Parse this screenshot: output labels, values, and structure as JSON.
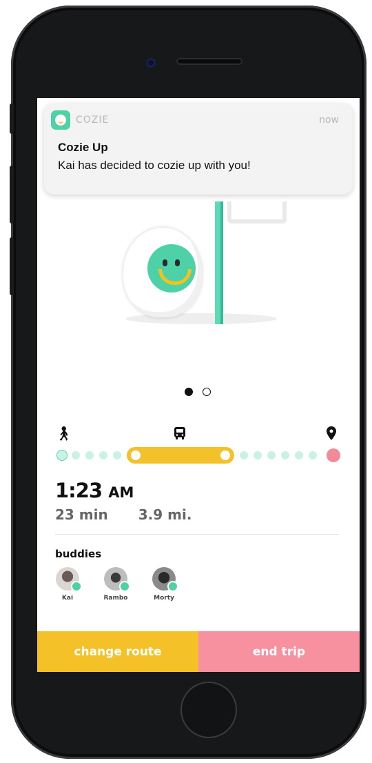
{
  "notification": {
    "app_name": "COZIE",
    "time": "now",
    "title": "Cozie Up",
    "body": "Kai has decided to cozie up with you!",
    "accent_color": "#4fd1a8"
  },
  "carousel": {
    "active_index": 0,
    "count": 2
  },
  "route": {
    "icons": [
      "walk-icon",
      "bus-icon",
      "location-pin-icon"
    ],
    "colors": {
      "walk": "#c8f3e4",
      "bus": "#f3c12a",
      "destination": "#f38a98"
    }
  },
  "trip": {
    "arrival_time": "1:23",
    "arrival_ampm": "AM",
    "duration": "23 min",
    "distance": "3.9 mi."
  },
  "buddies": {
    "title": "buddies",
    "items": [
      {
        "name": "Kai",
        "online": true
      },
      {
        "name": "Rambo",
        "online": true
      },
      {
        "name": "Morty",
        "online": true
      }
    ]
  },
  "actions": {
    "change_route": "change route",
    "end_trip": "end trip",
    "change_color": "#f4c228",
    "end_color": "#f7919f"
  }
}
